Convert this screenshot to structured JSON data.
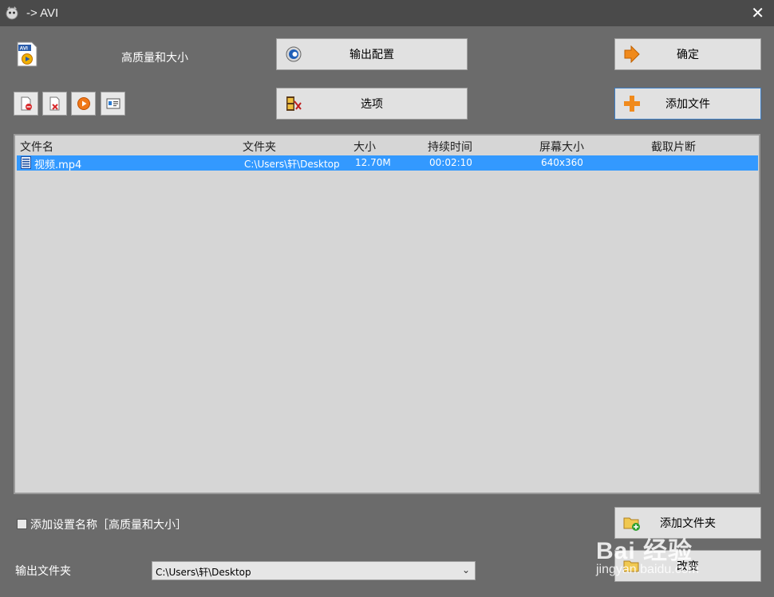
{
  "window": {
    "title": "-> AVI",
    "close_glyph": "✕"
  },
  "preset": {
    "label": "高质量和大小",
    "icon": "avi-file-icon"
  },
  "buttons": {
    "output_config": "输出配置",
    "options": "选项",
    "ok": "确定",
    "add_file": "添加文件",
    "add_folder": "添加文件夹",
    "change": "改变"
  },
  "toolbar_icons": [
    "remove-file-icon",
    "clear-list-icon",
    "play-icon",
    "info-icon"
  ],
  "file_list": {
    "columns": [
      "文件名",
      "文件夹",
      "大小",
      "持续时间",
      "屏幕大小",
      "截取片断"
    ],
    "rows": [
      {
        "name": "视频.mp4",
        "folder": "C:\\Users\\轩\\Desktop",
        "size": "12.70M",
        "duration": "00:02:10",
        "resolution": "640x360",
        "clip": "",
        "selected": true
      }
    ]
  },
  "settings": {
    "add_name_label": "添加设置名称［高质量和大小］",
    "add_name_checked": false,
    "output_folder_label": "输出文件夹",
    "output_folder_value": "C:\\Users\\轩\\Desktop"
  },
  "watermark": {
    "brand": "Bai 经验",
    "url": "jingyan.baidu.com"
  },
  "colors": {
    "background": "#6b6b6b",
    "titlebar": "#4a4a4a",
    "selection": "#3399ff",
    "list_bg": "#d6d6d6"
  }
}
